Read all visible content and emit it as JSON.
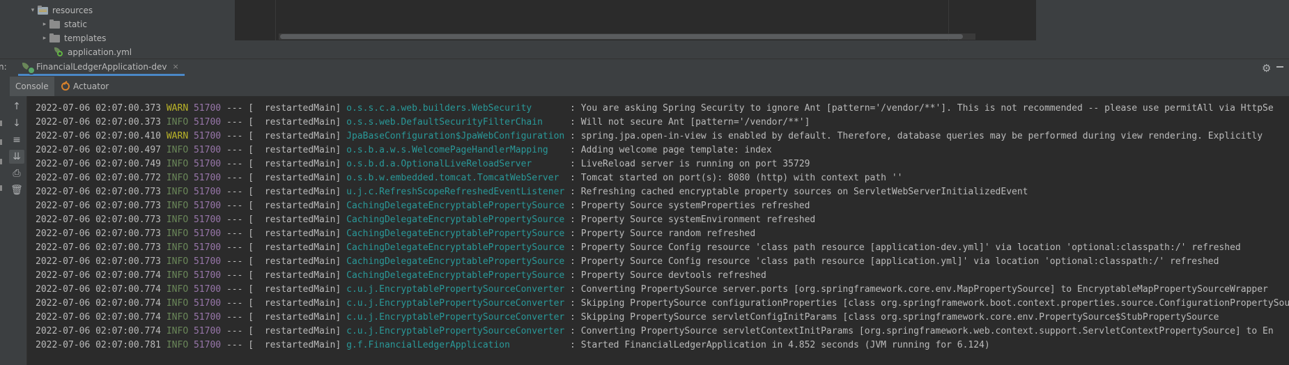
{
  "project_tree": {
    "items": [
      {
        "label": "resources",
        "arrow": "▾",
        "type": "resources-folder"
      },
      {
        "label": "static",
        "arrow": "▸",
        "type": "folder"
      },
      {
        "label": "templates",
        "arrow": "▸",
        "type": "folder"
      },
      {
        "label": "application.yml",
        "arrow": "",
        "type": "yml-file"
      }
    ]
  },
  "run_panel": {
    "label": "n:",
    "tab_title": "FinancialLedgerApplication-dev",
    "close_glyph": "×",
    "gear_glyph": "⚙"
  },
  "sub_tabs": {
    "console": "Console",
    "actuator": "Actuator"
  },
  "toolbar": {
    "icons": [
      "↑",
      "↓",
      "≡",
      "⇊",
      "⎙",
      "🗑"
    ]
  },
  "colors": {
    "warn": "#bbb529",
    "info": "#6a8759",
    "pid": "#9876aa",
    "logger": "#299999"
  },
  "log_lines": [
    {
      "ts": "2022-07-06 02:07:00.373",
      "level": "WARN",
      "pid": "51700",
      "sep": " --- [",
      "thread": "  restartedMain]",
      "logger": " o.s.s.c.a.web.builders.WebSecurity      ",
      "msg": " : You are asking Spring Security to ignore Ant [pattern='/vendor/**']. This is not recommended -- please use permitAll via HttpSe"
    },
    {
      "ts": "2022-07-06 02:07:00.373",
      "level": "INFO",
      "pid": "51700",
      "sep": " --- [",
      "thread": "  restartedMain]",
      "logger": " o.s.s.web.DefaultSecurityFilterChain    ",
      "msg": " : Will not secure Ant [pattern='/vendor/**']"
    },
    {
      "ts": "2022-07-06 02:07:00.410",
      "level": "WARN",
      "pid": "51700",
      "sep": " --- [",
      "thread": "  restartedMain]",
      "logger": " JpaBaseConfiguration$JpaWebConfiguration",
      "msg": " : spring.jpa.open-in-view is enabled by default. Therefore, database queries may be performed during view rendering. Explicitly"
    },
    {
      "ts": "2022-07-06 02:07:00.497",
      "level": "INFO",
      "pid": "51700",
      "sep": " --- [",
      "thread": "  restartedMain]",
      "logger": " o.s.b.a.w.s.WelcomePageHandlerMapping   ",
      "msg": " : Adding welcome page template: index"
    },
    {
      "ts": "2022-07-06 02:07:00.749",
      "level": "INFO",
      "pid": "51700",
      "sep": " --- [",
      "thread": "  restartedMain]",
      "logger": " o.s.b.d.a.OptionalLiveReloadServer      ",
      "msg": " : LiveReload server is running on port 35729"
    },
    {
      "ts": "2022-07-06 02:07:00.772",
      "level": "INFO",
      "pid": "51700",
      "sep": " --- [",
      "thread": "  restartedMain]",
      "logger": " o.s.b.w.embedded.tomcat.TomcatWebServer ",
      "msg": " : Tomcat started on port(s): 8080 (http) with context path ''"
    },
    {
      "ts": "2022-07-06 02:07:00.773",
      "level": "INFO",
      "pid": "51700",
      "sep": " --- [",
      "thread": "  restartedMain]",
      "logger": " u.j.c.RefreshScopeRefreshedEventListener",
      "msg": " : Refreshing cached encryptable property sources on ServletWebServerInitializedEvent"
    },
    {
      "ts": "2022-07-06 02:07:00.773",
      "level": "INFO",
      "pid": "51700",
      "sep": " --- [",
      "thread": "  restartedMain]",
      "logger": " CachingDelegateEncryptablePropertySource",
      "msg": " : Property Source systemProperties refreshed"
    },
    {
      "ts": "2022-07-06 02:07:00.773",
      "level": "INFO",
      "pid": "51700",
      "sep": " --- [",
      "thread": "  restartedMain]",
      "logger": " CachingDelegateEncryptablePropertySource",
      "msg": " : Property Source systemEnvironment refreshed"
    },
    {
      "ts": "2022-07-06 02:07:00.773",
      "level": "INFO",
      "pid": "51700",
      "sep": " --- [",
      "thread": "  restartedMain]",
      "logger": " CachingDelegateEncryptablePropertySource",
      "msg": " : Property Source random refreshed"
    },
    {
      "ts": "2022-07-06 02:07:00.773",
      "level": "INFO",
      "pid": "51700",
      "sep": " --- [",
      "thread": "  restartedMain]",
      "logger": " CachingDelegateEncryptablePropertySource",
      "msg": " : Property Source Config resource 'class path resource [application-dev.yml]' via location 'optional:classpath:/' refreshed"
    },
    {
      "ts": "2022-07-06 02:07:00.773",
      "level": "INFO",
      "pid": "51700",
      "sep": " --- [",
      "thread": "  restartedMain]",
      "logger": " CachingDelegateEncryptablePropertySource",
      "msg": " : Property Source Config resource 'class path resource [application.yml]' via location 'optional:classpath:/' refreshed"
    },
    {
      "ts": "2022-07-06 02:07:00.774",
      "level": "INFO",
      "pid": "51700",
      "sep": " --- [",
      "thread": "  restartedMain]",
      "logger": " CachingDelegateEncryptablePropertySource",
      "msg": " : Property Source devtools refreshed"
    },
    {
      "ts": "2022-07-06 02:07:00.774",
      "level": "INFO",
      "pid": "51700",
      "sep": " --- [",
      "thread": "  restartedMain]",
      "logger": " c.u.j.EncryptablePropertySourceConverter",
      "msg": " : Converting PropertySource server.ports [org.springframework.core.env.MapPropertySource] to EncryptableMapPropertySourceWrapper"
    },
    {
      "ts": "2022-07-06 02:07:00.774",
      "level": "INFO",
      "pid": "51700",
      "sep": " --- [",
      "thread": "  restartedMain]",
      "logger": " c.u.j.EncryptablePropertySourceConverter",
      "msg": " : Skipping PropertySource configurationProperties [class org.springframework.boot.context.properties.source.ConfigurationPropertySourcesPro"
    },
    {
      "ts": "2022-07-06 02:07:00.774",
      "level": "INFO",
      "pid": "51700",
      "sep": " --- [",
      "thread": "  restartedMain]",
      "logger": " c.u.j.EncryptablePropertySourceConverter",
      "msg": " : Skipping PropertySource servletConfigInitParams [class org.springframework.core.env.PropertySource$StubPropertySource"
    },
    {
      "ts": "2022-07-06 02:07:00.774",
      "level": "INFO",
      "pid": "51700",
      "sep": " --- [",
      "thread": "  restartedMain]",
      "logger": " c.u.j.EncryptablePropertySourceConverter",
      "msg": " : Converting PropertySource servletContextInitParams [org.springframework.web.context.support.ServletContextPropertySource] to En"
    },
    {
      "ts": "2022-07-06 02:07:00.781",
      "level": "INFO",
      "pid": "51700",
      "sep": " --- [",
      "thread": "  restartedMain]",
      "logger": " g.f.FinancialLedgerApplication          ",
      "msg": " : Started FinancialLedgerApplication in 4.852 seconds (JVM running for 6.124)"
    }
  ]
}
